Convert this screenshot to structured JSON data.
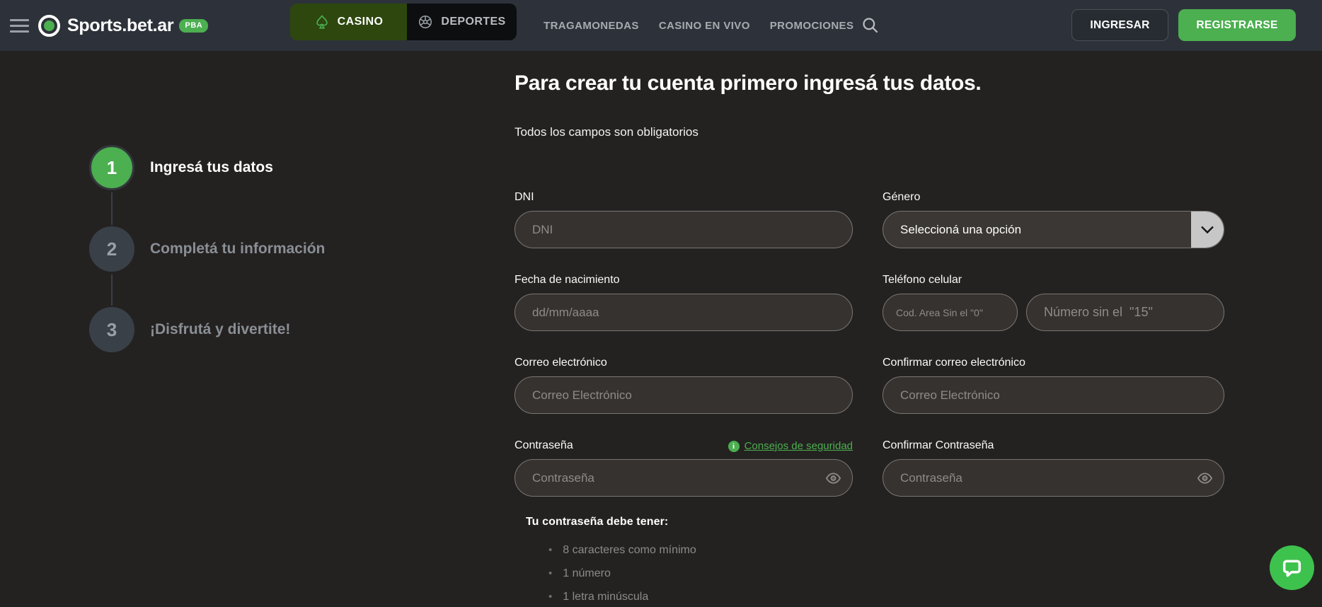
{
  "nav": {
    "brand": {
      "name": "Sports.bet.ar",
      "badge": "PBA"
    },
    "tabs": [
      {
        "label": "CASINO",
        "icon": "spade-icon"
      },
      {
        "label": "DEPORTES",
        "icon": "ball-icon"
      }
    ],
    "links": [
      "TRAGAMONEDAS",
      "CASINO EN VIVO",
      "PROMOCIONES"
    ],
    "login_label": "INGRESAR",
    "register_label": "REGISTRARSE"
  },
  "steps": [
    {
      "number": "1",
      "label": "Ingresá tus datos",
      "state": "active"
    },
    {
      "number": "2",
      "label": "Completá tu información",
      "state": "inactive"
    },
    {
      "number": "3",
      "label": "¡Disfrutá y divertite!",
      "state": "inactive"
    }
  ],
  "form": {
    "title": "Para crear tu cuenta primero ingresá tus datos.",
    "subtitle": "Todos los campos son obligatorios",
    "fields": {
      "dni": {
        "label": "DNI",
        "placeholder": "DNI"
      },
      "genero": {
        "label": "Género",
        "selected": "Seleccioná una opción"
      },
      "fecha_nacimiento": {
        "label": "Fecha de nacimiento",
        "placeholder": "dd/mm/aaaa"
      },
      "telefono": {
        "label": "Teléfono celular",
        "area_placeholder": "Cod. Area Sin el \"0\"",
        "numero_placeholder": "Número sin el  \"15\""
      },
      "correo": {
        "label": "Correo electrónico",
        "placeholder": "Correo Electrónico"
      },
      "confirmar_correo": {
        "label": "Confirmar correo electrónico",
        "placeholder": "Correo Electrónico"
      },
      "contrasena": {
        "label": "Contraseña",
        "placeholder": "Contraseña",
        "tips_link": "Consejos de seguridad"
      },
      "confirmar_contrasena": {
        "label": "Confirmar Contraseña",
        "placeholder": "Contraseña"
      }
    },
    "password_rules": {
      "title": "Tu contraseña debe tener:",
      "items": [
        "8 caracteres como mínimo",
        "1 número",
        "1 letra minúscula"
      ]
    }
  },
  "colors": {
    "accent_green": "#4caf50",
    "chat_green": "#3ec24e",
    "navbar_bg": "#2d323a",
    "body_bg": "#242221",
    "casino_tab_bg": "#2d470e"
  }
}
